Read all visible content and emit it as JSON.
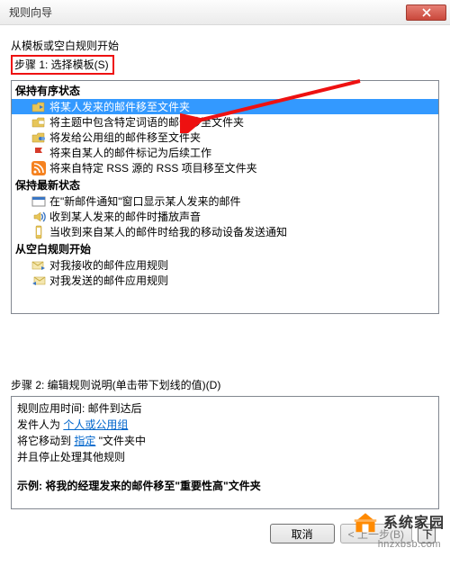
{
  "window": {
    "title": "规则向导"
  },
  "intro": "从模板或空白规则开始",
  "step1_label": "步骤 1: 选择模板(S)",
  "sections": {
    "ordered": {
      "title": "保持有序状态",
      "items": [
        "将某人发来的邮件移至文件夹",
        "将主题中包含特定词语的邮件移至文件夹",
        "将发给公用组的邮件移至文件夹",
        "将来自某人的邮件标记为后续工作",
        "将来自特定 RSS 源的 RSS 项目移至文件夹"
      ]
    },
    "updated": {
      "title": "保持最新状态",
      "items": [
        "在\"新邮件通知\"窗口显示某人发来的邮件",
        "收到某人发来的邮件时播放声音",
        "当收到来自某人的邮件时给我的移动设备发送通知"
      ]
    },
    "blank": {
      "title": "从空白规则开始",
      "items": [
        "对我接收的邮件应用规则",
        "对我发送的邮件应用规则"
      ]
    }
  },
  "step2_label": "步骤 2: 编辑规则说明(单击带下划线的值)(D)",
  "description": {
    "line1": "规则应用时间: 邮件到达后",
    "line2_a": "发件人为 ",
    "line2_link": "个人或公用组",
    "line3_a": "将它移动到 ",
    "line3_link": "指定",
    "line3_b": " \"文件夹中",
    "line4": "并且停止处理其他规则",
    "example": "示例: 将我的经理发来的邮件移至\"重要性高\"文件夹"
  },
  "buttons": {
    "cancel": "取消",
    "back": "< 上一步(B)",
    "next": "下"
  },
  "watermark": {
    "text": "系统家园",
    "url": "hnzxbsb.com"
  }
}
